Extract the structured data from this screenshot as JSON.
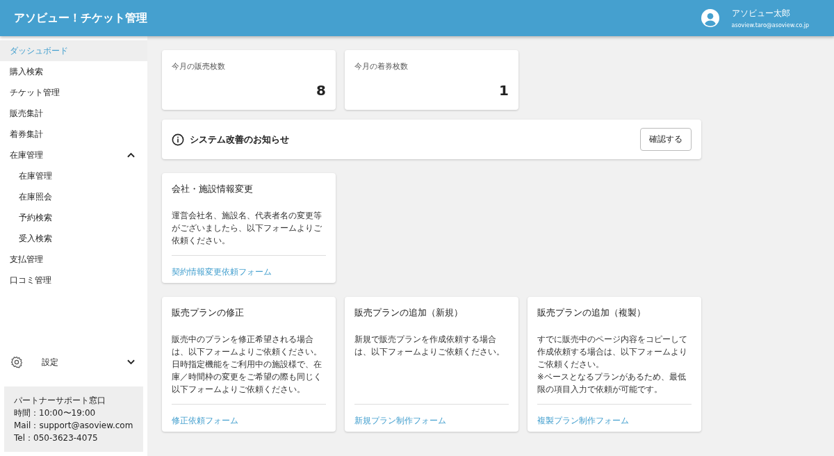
{
  "header": {
    "title": "アソビュー！チケット管理",
    "user_name": "アソビュー太郎",
    "user_email": "asoview.taro@asoview.co.jp"
  },
  "sidebar": {
    "items": [
      {
        "label": "ダッシュボード",
        "selected": true
      },
      {
        "label": "購入検索",
        "selected": false
      },
      {
        "label": "チケット管理",
        "selected": false
      },
      {
        "label": "販売集計",
        "selected": false
      },
      {
        "label": "着券集計",
        "selected": false
      },
      {
        "label": "在庫管理",
        "selected": false,
        "expanded": true,
        "children": [
          {
            "label": "在庫管理",
            "selected": false
          },
          {
            "label": "在庫照会",
            "selected": false
          },
          {
            "label": "予約検索",
            "selected": false
          },
          {
            "label": "受入検索",
            "selected": false
          }
        ]
      },
      {
        "label": "支払管理",
        "selected": false
      },
      {
        "label": "口コミ管理",
        "selected": false
      }
    ],
    "settings": {
      "label": "設定",
      "expanded": false
    },
    "support": [
      "パートナーサポート窓口",
      "時間：10:00〜19:00",
      "Mail：support@asoview.com",
      "Tel：050-3623-4075"
    ]
  },
  "stats": [
    {
      "label": "今月の販売枚数",
      "value": "8"
    },
    {
      "label": "今月の着券枚数",
      "value": "1"
    }
  ],
  "notice": {
    "title": "システム改善のお知らせ",
    "button": "確認する"
  },
  "card_rows": [
    [
      {
        "title": "会社・施設情報変更",
        "body": "運営会社名、施設名、代表者名の変更等がございましたら、以下フォームよりご依頼ください。",
        "link": "契約情報変更依頼フォーム"
      }
    ],
    [
      {
        "title": "販売プランの修正",
        "body": "販売中のプランを修正希望される場合は、以下フォームよりご依頼ください。日時指定機能をご利用中の施設様で、在庫／時間枠の変更をご希望の際も同じく以下フォームよりご依頼ください。",
        "link": "修正依頼フォーム"
      },
      {
        "title": "販売プランの追加（新規）",
        "body": "新規で販売プランを作成依頼する場合は、以下フォームよりご依頼ください。",
        "link": "新規プラン制作フォーム"
      },
      {
        "title": "販売プランの追加（複製）",
        "body": "すでに販売中のページ内容をコピーして作成依頼する場合は、以下フォームよりご依頼ください。\n※ベースとなるプランがあるため、最低限の項目入力で依頼が可能です。",
        "link": "複製プラン制作フォーム"
      }
    ]
  ]
}
